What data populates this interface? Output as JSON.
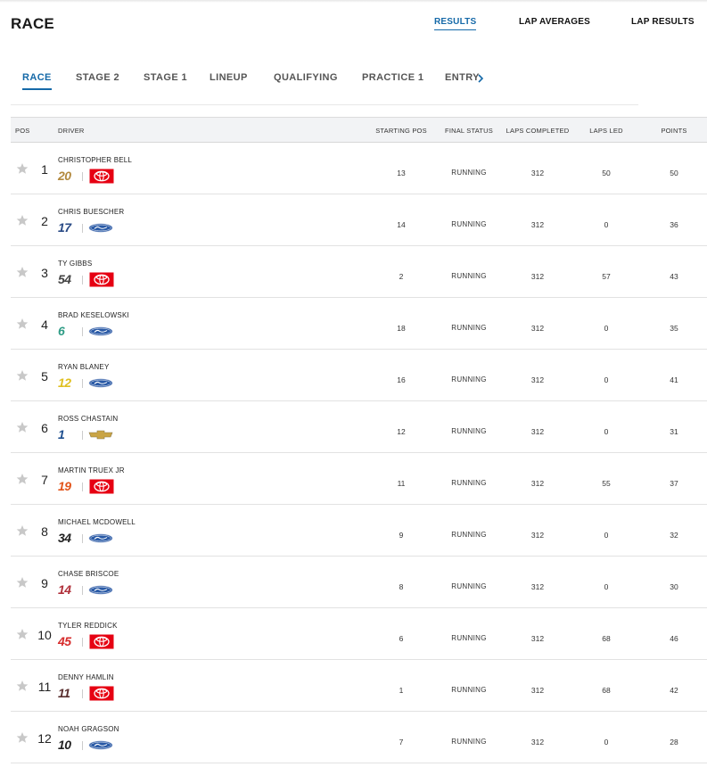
{
  "header": {
    "title": "RACE",
    "nav": [
      {
        "label": "RESULTS",
        "active": true
      },
      {
        "label": "LAP AVERAGES",
        "active": false
      },
      {
        "label": "LAP RESULTS",
        "active": false
      }
    ]
  },
  "tabs": [
    {
      "label": "RACE",
      "active": true
    },
    {
      "label": "STAGE 2",
      "active": false
    },
    {
      "label": "STAGE 1",
      "active": false
    },
    {
      "label": "LINEUP",
      "active": false
    },
    {
      "label": "QUALIFYING",
      "active": false
    },
    {
      "label": "PRACTICE 1",
      "active": false
    },
    {
      "label": "ENTRY",
      "active": false
    }
  ],
  "table": {
    "columns": {
      "pos": "POS",
      "driver": "DRIVER",
      "starting_pos": "STARTING POS",
      "final_status": "FINAL STATUS",
      "laps_completed": "LAPS COMPLETED",
      "laps_led": "LAPS LED",
      "points": "POINTS"
    },
    "rows": [
      {
        "pos": "1",
        "driver": "CHRISTOPHER BELL",
        "car_number": "20",
        "number_color": "#b38a3f",
        "make": "toyota",
        "starting_pos": "13",
        "final_status": "RUNNING",
        "laps_completed": "312",
        "laps_led": "50",
        "points": "50"
      },
      {
        "pos": "2",
        "driver": "CHRIS BUESCHER",
        "car_number": "17",
        "number_color": "#2a4b86",
        "make": "ford",
        "starting_pos": "14",
        "final_status": "RUNNING",
        "laps_completed": "312",
        "laps_led": "0",
        "points": "36"
      },
      {
        "pos": "3",
        "driver": "TY GIBBS",
        "car_number": "54",
        "number_color": "#444444",
        "make": "toyota",
        "starting_pos": "2",
        "final_status": "RUNNING",
        "laps_completed": "312",
        "laps_led": "57",
        "points": "43"
      },
      {
        "pos": "4",
        "driver": "BRAD KESELOWSKI",
        "car_number": "6",
        "number_color": "#2f9c86",
        "make": "ford",
        "starting_pos": "18",
        "final_status": "RUNNING",
        "laps_completed": "312",
        "laps_led": "0",
        "points": "35"
      },
      {
        "pos": "5",
        "driver": "RYAN BLANEY",
        "car_number": "12",
        "number_color": "#e0c020",
        "make": "ford",
        "starting_pos": "16",
        "final_status": "RUNNING",
        "laps_completed": "312",
        "laps_led": "0",
        "points": "41"
      },
      {
        "pos": "6",
        "driver": "ROSS CHASTAIN",
        "car_number": "1",
        "number_color": "#1f4f8f",
        "make": "chevrolet",
        "starting_pos": "12",
        "final_status": "RUNNING",
        "laps_completed": "312",
        "laps_led": "0",
        "points": "31"
      },
      {
        "pos": "7",
        "driver": "MARTIN TRUEX JR",
        "car_number": "19",
        "number_color": "#e2541a",
        "make": "toyota",
        "starting_pos": "11",
        "final_status": "RUNNING",
        "laps_completed": "312",
        "laps_led": "55",
        "points": "37"
      },
      {
        "pos": "8",
        "driver": "MICHAEL MCDOWELL",
        "car_number": "34",
        "number_color": "#222222",
        "make": "ford",
        "starting_pos": "9",
        "final_status": "RUNNING",
        "laps_completed": "312",
        "laps_led": "0",
        "points": "32"
      },
      {
        "pos": "9",
        "driver": "CHASE BRISCOE",
        "car_number": "14",
        "number_color": "#b0303a",
        "make": "ford",
        "starting_pos": "8",
        "final_status": "RUNNING",
        "laps_completed": "312",
        "laps_led": "0",
        "points": "30"
      },
      {
        "pos": "10",
        "driver": "TYLER REDDICK",
        "car_number": "45",
        "number_color": "#d62a2a",
        "make": "toyota",
        "starting_pos": "6",
        "final_status": "RUNNING",
        "laps_completed": "312",
        "laps_led": "68",
        "points": "46"
      },
      {
        "pos": "11",
        "driver": "DENNY HAMLIN",
        "car_number": "11",
        "number_color": "#5a2f2f",
        "make": "toyota",
        "starting_pos": "1",
        "final_status": "RUNNING",
        "laps_completed": "312",
        "laps_led": "68",
        "points": "42"
      },
      {
        "pos": "12",
        "driver": "NOAH GRAGSON",
        "car_number": "10",
        "number_color": "#222222",
        "make": "ford",
        "starting_pos": "7",
        "final_status": "RUNNING",
        "laps_completed": "312",
        "laps_led": "0",
        "points": "28"
      }
    ]
  },
  "colors": {
    "accent": "#1569a8",
    "toyota_red": "#e60012",
    "ford_blue": "#2a5aa6",
    "chevy_gold": "#c9a445",
    "star_gray": "#c8c8c8"
  },
  "icons": {
    "star": "star-icon",
    "scroll_arrow": "chevron-right-icon",
    "manufacturers": [
      "toyota-logo-icon",
      "ford-logo-icon",
      "chevrolet-logo-icon"
    ]
  }
}
